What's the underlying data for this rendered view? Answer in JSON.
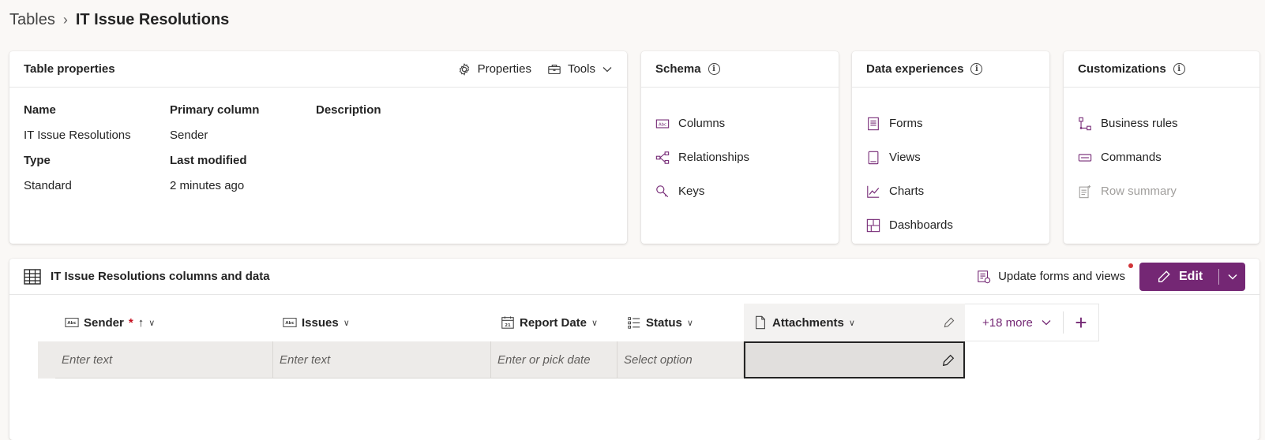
{
  "breadcrumb": {
    "root": "Tables",
    "current": "IT Issue Resolutions"
  },
  "properties_card": {
    "title": "Table properties",
    "actions": {
      "properties": "Properties",
      "tools": "Tools"
    },
    "fields": {
      "name_label": "Name",
      "name_value": "IT Issue Resolutions",
      "type_label": "Type",
      "type_value": "Standard",
      "primary_label": "Primary column",
      "primary_value": "Sender",
      "modified_label": "Last modified",
      "modified_value": "2 minutes ago",
      "description_label": "Description"
    }
  },
  "schema_card": {
    "title": "Schema",
    "items": [
      {
        "label": "Columns",
        "icon": "abc-column-icon"
      },
      {
        "label": "Relationships",
        "icon": "relationships-icon"
      },
      {
        "label": "Keys",
        "icon": "key-icon"
      }
    ]
  },
  "data_card": {
    "title": "Data experiences",
    "items": [
      {
        "label": "Forms",
        "icon": "form-icon"
      },
      {
        "label": "Views",
        "icon": "view-icon"
      },
      {
        "label": "Charts",
        "icon": "chart-icon"
      },
      {
        "label": "Dashboards",
        "icon": "dashboard-icon"
      }
    ]
  },
  "custom_card": {
    "title": "Customizations",
    "items": [
      {
        "label": "Business rules",
        "icon": "business-rules-icon"
      },
      {
        "label": "Commands",
        "icon": "commands-icon"
      },
      {
        "label": "Row summary",
        "icon": "row-summary-icon",
        "disabled": true
      }
    ]
  },
  "grid": {
    "title": "IT Issue Resolutions columns and data",
    "update_label": "Update forms and views",
    "edit_label": "Edit",
    "accent": "#742774",
    "columns": [
      {
        "label": "Sender",
        "required_mark": "*",
        "sort": "ascending",
        "placeholder": "Enter text"
      },
      {
        "label": "Issues",
        "placeholder": "Enter text"
      },
      {
        "label": "Report Date",
        "placeholder": "Enter or pick date"
      },
      {
        "label": "Status",
        "placeholder": "Select option"
      },
      {
        "label": "Attachments",
        "placeholder": ""
      }
    ],
    "more_label": "+18 more",
    "add_column": "+"
  }
}
